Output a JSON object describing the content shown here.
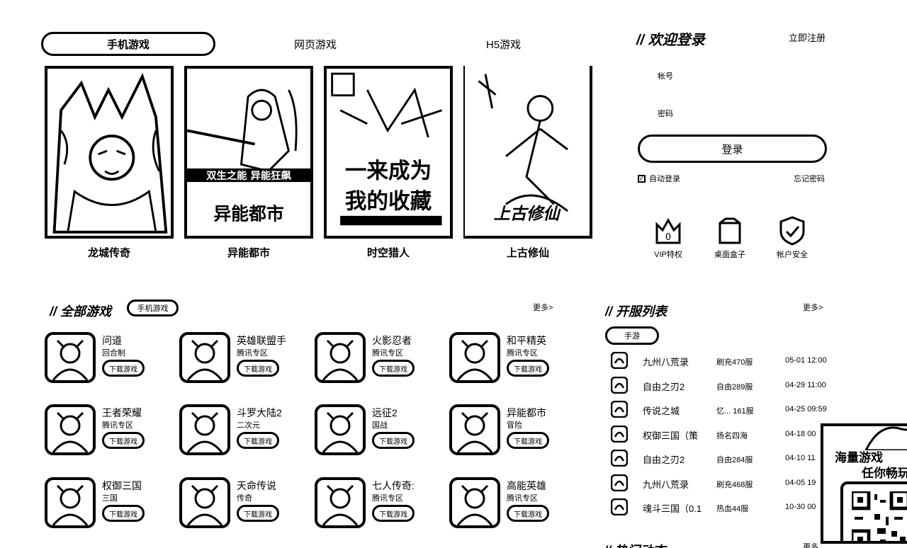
{
  "tabs": {
    "active": "手机游戏",
    "web": "网页游戏",
    "h5": "H5游戏"
  },
  "featured": [
    {
      "name": "龙城传奇"
    },
    {
      "name": "异能都市",
      "art_text_1": "双生之能 异能狂飙",
      "art_text_2": "异能都市"
    },
    {
      "name": "时空猎人",
      "art_text_1": "一来成为",
      "art_text_2": "我的收藏"
    },
    {
      "name": "上古修仙",
      "art_text_1": "上古修仙"
    }
  ],
  "login": {
    "title": "// 欢迎登录",
    "register": "立即注册",
    "account_label": "帐号",
    "password_label": "密码",
    "button": "登录",
    "auto_login": "自动登录",
    "forgot": "忘记密码",
    "perks": [
      {
        "label": "VIP特权",
        "icon": "crown-icon"
      },
      {
        "label": "桌面盒子",
        "icon": "box-icon"
      },
      {
        "label": "帐户安全",
        "icon": "shield-check-icon"
      }
    ]
  },
  "all_games": {
    "title": "// 全部游戏",
    "filter": "手机游戏",
    "more": "更多>",
    "download_label": "下载游戏",
    "items": [
      {
        "name": "问道",
        "sub": "回合制"
      },
      {
        "name": "英雄联盟手",
        "sub": "腾讯专区"
      },
      {
        "name": "火影忍者",
        "sub": "腾讯专区"
      },
      {
        "name": "和平精英",
        "sub": "腾讯专区"
      },
      {
        "name": "王者荣耀",
        "sub": "腾讯专区"
      },
      {
        "name": "斗罗大陆2",
        "sub": "二次元"
      },
      {
        "name": "远征2",
        "sub": "国战"
      },
      {
        "name": "异能都市",
        "sub": "冒险"
      },
      {
        "name": "权御三国",
        "sub": "三国"
      },
      {
        "name": "天命传说",
        "sub": "传奇"
      },
      {
        "name": "七人传奇:",
        "sub": "腾讯专区"
      },
      {
        "name": "高能英雄",
        "sub": "腾讯专区"
      }
    ]
  },
  "servers": {
    "title": "// 开服列表",
    "filter": "手游",
    "more": "更多>",
    "items": [
      {
        "name": "九州八荒录",
        "zone": "刷充470服",
        "time": "05-01 12:00"
      },
      {
        "name": "自由之刃2",
        "zone": "自由289服",
        "time": "04-29 11:00"
      },
      {
        "name": "传说之城",
        "zone": "忆... 161服",
        "time": "04-25 09:59"
      },
      {
        "name": "权御三国（策",
        "zone": "扬名四海",
        "time": "04-18 00"
      },
      {
        "name": "自由之刃2",
        "zone": "自由284服",
        "time": "04-10 11"
      },
      {
        "name": "九州八荒录",
        "zone": "刷充468服",
        "time": "04-05 19"
      },
      {
        "name": "魂斗三国（0.1",
        "zone": "热血44服",
        "time": "10-30 00"
      }
    ]
  },
  "qr_popup": {
    "title": "海量游戏",
    "subtitle": "任你畅玩"
  },
  "news": {
    "title": "// 热门动态",
    "more": "更多"
  }
}
